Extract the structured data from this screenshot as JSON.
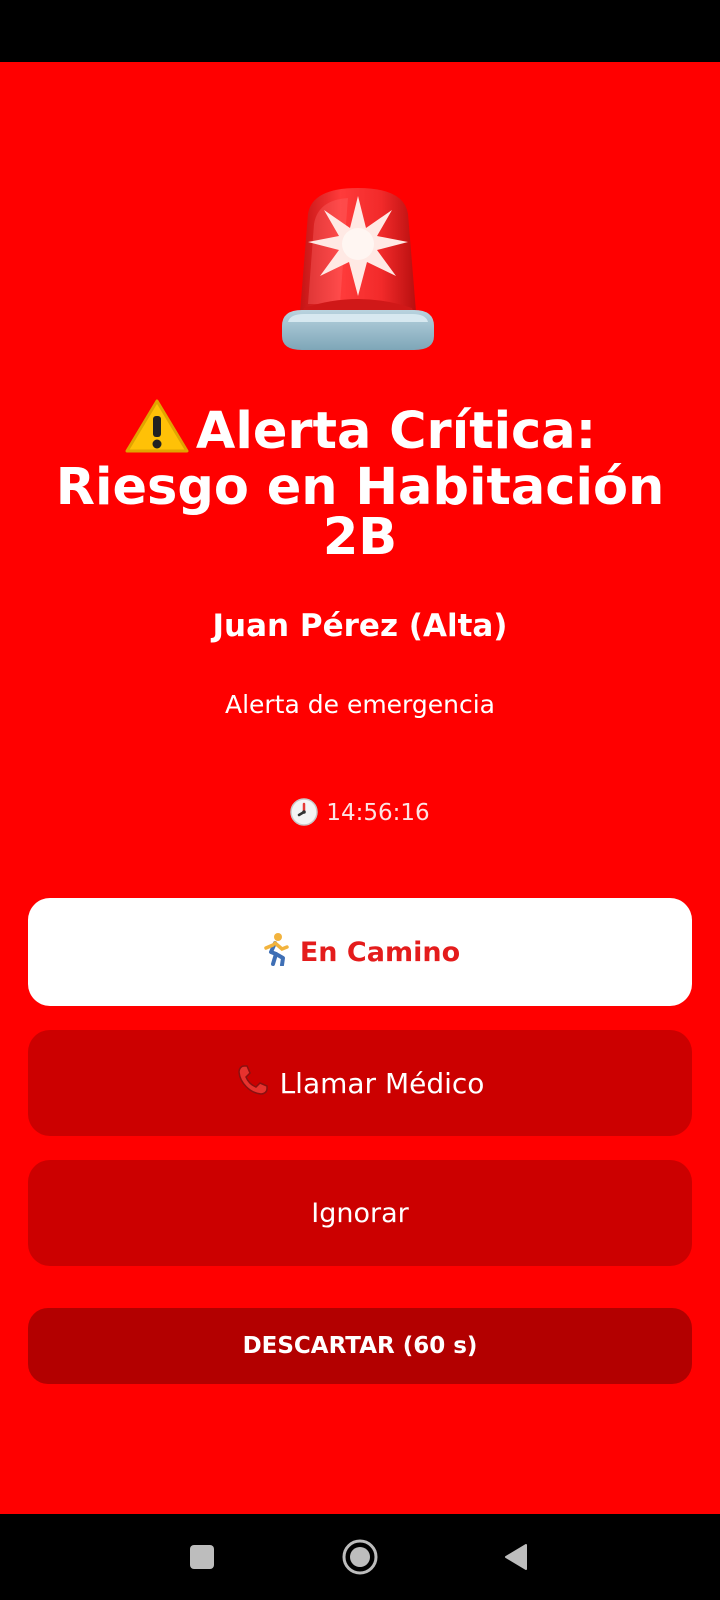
{
  "alert": {
    "title": "Alerta Crítica: Riesgo en Habitación 2B",
    "patient": "Juan Pérez (Alta)",
    "type": "Alerta de emergencia",
    "time": "14:56:16"
  },
  "actions": {
    "on_way_label": "En Camino",
    "call_doctor_label": "Llamar Médico",
    "ignore_label": "Ignorar",
    "dismiss_label": "DESCARTAR (60 s)"
  },
  "icons": {
    "header": "police-siren-icon",
    "title_prefix": "warning-icon",
    "time": "clock-icon",
    "on_way": "running-person-icon",
    "call": "telephone-icon",
    "nav": [
      "recent-apps-square-icon",
      "home-circle-icon",
      "back-triangle-icon"
    ]
  },
  "colors": {
    "background": "#ff0000",
    "primary_button_bg": "#ffffff",
    "primary_button_text": "#e41c1c",
    "secondary_button_bg": "#cc0000",
    "dismiss_button_bg": "#b30000"
  }
}
